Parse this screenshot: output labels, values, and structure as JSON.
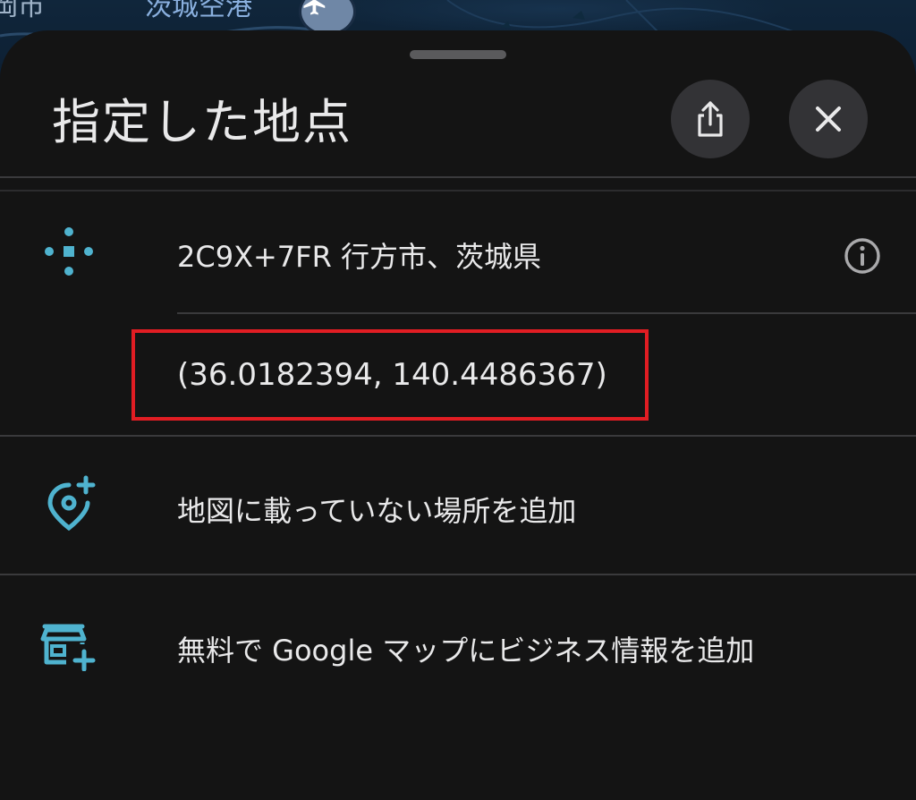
{
  "map": {
    "label_left": "岡市",
    "label_airport": "茨城空港",
    "airport_icon": "airplane-icon"
  },
  "sheet": {
    "title": "指定した地点",
    "share_icon": "share-icon",
    "close_icon": "close-icon"
  },
  "rows": {
    "plus_code": {
      "text": "2C9X+7FR 行方市、茨城県",
      "icon": "plus-code-icon",
      "info_icon": "info-icon"
    },
    "coordinates": {
      "text": "(36.0182394, 140.4486367)"
    },
    "add_missing_place": {
      "text": "地図に載っていない場所を追加",
      "icon": "add-location-pin-icon"
    },
    "add_business": {
      "text": "無料で Google マップにビジネス情報を追加",
      "icon": "add-storefront-icon"
    }
  },
  "colors": {
    "sheet_background": "#141414",
    "accent_icon": "#4fb3cf",
    "highlight_border": "#e11d23",
    "button_background": "#333336"
  }
}
